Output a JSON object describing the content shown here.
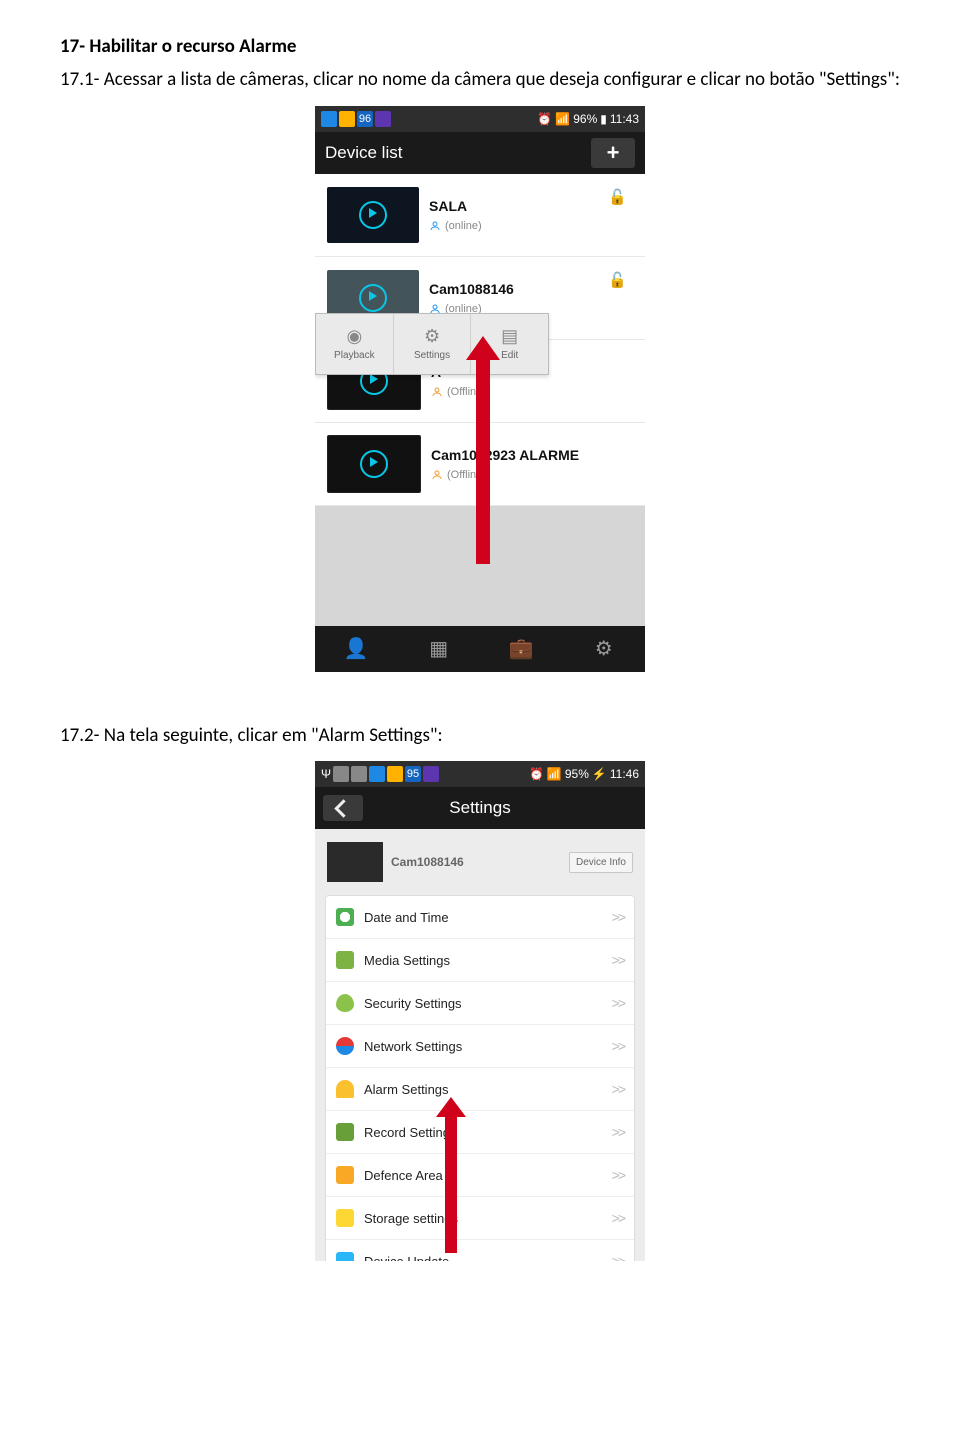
{
  "doc": {
    "heading": "17- Habilitar o recurso Alarme",
    "p1": "17.1- Acessar a lista de câmeras, clicar no nome da câmera que deseja configurar e clicar no botão \"Settings\":",
    "p2": "17.2- Na tela seguinte, clicar em \"Alarm Settings\":"
  },
  "phone1": {
    "statusBadge": "96",
    "signalPct": "96%",
    "time": "11:43",
    "title": "Device list",
    "plus": "+",
    "items": [
      {
        "name": "SALA",
        "status": "(online)",
        "online": true
      },
      {
        "name": "Cam1088146",
        "status": "(online)",
        "online": true
      },
      {
        "name": "A",
        "status": "(Offline)",
        "online": false
      },
      {
        "name": "Cam1092923 ALARME",
        "status": "(Offline)",
        "online": false
      }
    ],
    "popup": {
      "playback": "Playback",
      "settings": "Settings",
      "edit": "Edit"
    }
  },
  "phone2": {
    "statusBadge": "95",
    "signalPct": "95%",
    "time": "11:46",
    "title": "Settings",
    "device": "Cam1088146",
    "deviceInfo": "Device Info",
    "rows": [
      {
        "label": "Date and Time",
        "color": "#4caf50"
      },
      {
        "label": "Media Settings",
        "color": "#7cb342"
      },
      {
        "label": "Security Settings",
        "color": "#8bc34a"
      },
      {
        "label": "Network Settings",
        "color": "#e53935"
      },
      {
        "label": "Alarm Settings",
        "color": "#fbc02d"
      },
      {
        "label": "Record Settings",
        "color": "#689f38"
      },
      {
        "label": "Defence Area",
        "color": "#f9a825"
      },
      {
        "label": "Storage settings",
        "color": "#fdd835"
      },
      {
        "label": "Device Update",
        "color": "#29b6f6"
      }
    ]
  }
}
